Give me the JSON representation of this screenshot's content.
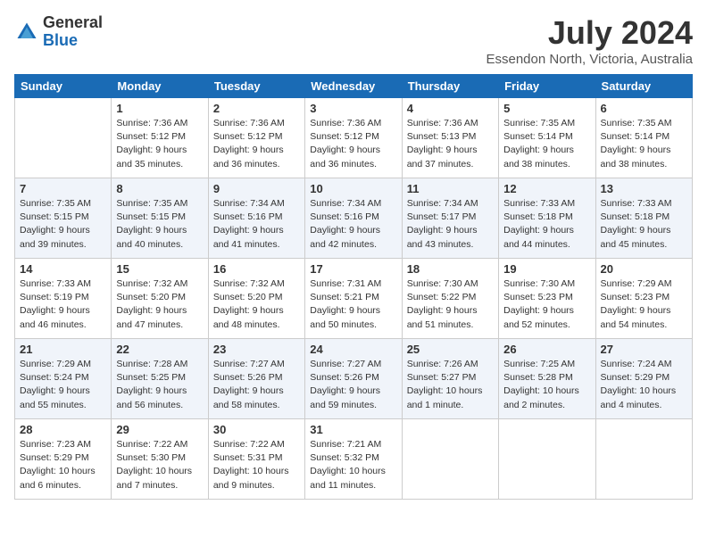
{
  "header": {
    "logo_general": "General",
    "logo_blue": "Blue",
    "month_title": "July 2024",
    "location": "Essendon North, Victoria, Australia"
  },
  "weekdays": [
    "Sunday",
    "Monday",
    "Tuesday",
    "Wednesday",
    "Thursday",
    "Friday",
    "Saturday"
  ],
  "weeks": [
    [
      {
        "day": "",
        "sunrise": "",
        "sunset": "",
        "daylight": ""
      },
      {
        "day": "1",
        "sunrise": "Sunrise: 7:36 AM",
        "sunset": "Sunset: 5:12 PM",
        "daylight": "Daylight: 9 hours and 35 minutes."
      },
      {
        "day": "2",
        "sunrise": "Sunrise: 7:36 AM",
        "sunset": "Sunset: 5:12 PM",
        "daylight": "Daylight: 9 hours and 36 minutes."
      },
      {
        "day": "3",
        "sunrise": "Sunrise: 7:36 AM",
        "sunset": "Sunset: 5:12 PM",
        "daylight": "Daylight: 9 hours and 36 minutes."
      },
      {
        "day": "4",
        "sunrise": "Sunrise: 7:36 AM",
        "sunset": "Sunset: 5:13 PM",
        "daylight": "Daylight: 9 hours and 37 minutes."
      },
      {
        "day": "5",
        "sunrise": "Sunrise: 7:35 AM",
        "sunset": "Sunset: 5:14 PM",
        "daylight": "Daylight: 9 hours and 38 minutes."
      },
      {
        "day": "6",
        "sunrise": "Sunrise: 7:35 AM",
        "sunset": "Sunset: 5:14 PM",
        "daylight": "Daylight: 9 hours and 38 minutes."
      }
    ],
    [
      {
        "day": "7",
        "sunrise": "Sunrise: 7:35 AM",
        "sunset": "Sunset: 5:15 PM",
        "daylight": "Daylight: 9 hours and 39 minutes."
      },
      {
        "day": "8",
        "sunrise": "Sunrise: 7:35 AM",
        "sunset": "Sunset: 5:15 PM",
        "daylight": "Daylight: 9 hours and 40 minutes."
      },
      {
        "day": "9",
        "sunrise": "Sunrise: 7:34 AM",
        "sunset": "Sunset: 5:16 PM",
        "daylight": "Daylight: 9 hours and 41 minutes."
      },
      {
        "day": "10",
        "sunrise": "Sunrise: 7:34 AM",
        "sunset": "Sunset: 5:16 PM",
        "daylight": "Daylight: 9 hours and 42 minutes."
      },
      {
        "day": "11",
        "sunrise": "Sunrise: 7:34 AM",
        "sunset": "Sunset: 5:17 PM",
        "daylight": "Daylight: 9 hours and 43 minutes."
      },
      {
        "day": "12",
        "sunrise": "Sunrise: 7:33 AM",
        "sunset": "Sunset: 5:18 PM",
        "daylight": "Daylight: 9 hours and 44 minutes."
      },
      {
        "day": "13",
        "sunrise": "Sunrise: 7:33 AM",
        "sunset": "Sunset: 5:18 PM",
        "daylight": "Daylight: 9 hours and 45 minutes."
      }
    ],
    [
      {
        "day": "14",
        "sunrise": "Sunrise: 7:33 AM",
        "sunset": "Sunset: 5:19 PM",
        "daylight": "Daylight: 9 hours and 46 minutes."
      },
      {
        "day": "15",
        "sunrise": "Sunrise: 7:32 AM",
        "sunset": "Sunset: 5:20 PM",
        "daylight": "Daylight: 9 hours and 47 minutes."
      },
      {
        "day": "16",
        "sunrise": "Sunrise: 7:32 AM",
        "sunset": "Sunset: 5:20 PM",
        "daylight": "Daylight: 9 hours and 48 minutes."
      },
      {
        "day": "17",
        "sunrise": "Sunrise: 7:31 AM",
        "sunset": "Sunset: 5:21 PM",
        "daylight": "Daylight: 9 hours and 50 minutes."
      },
      {
        "day": "18",
        "sunrise": "Sunrise: 7:30 AM",
        "sunset": "Sunset: 5:22 PM",
        "daylight": "Daylight: 9 hours and 51 minutes."
      },
      {
        "day": "19",
        "sunrise": "Sunrise: 7:30 AM",
        "sunset": "Sunset: 5:23 PM",
        "daylight": "Daylight: 9 hours and 52 minutes."
      },
      {
        "day": "20",
        "sunrise": "Sunrise: 7:29 AM",
        "sunset": "Sunset: 5:23 PM",
        "daylight": "Daylight: 9 hours and 54 minutes."
      }
    ],
    [
      {
        "day": "21",
        "sunrise": "Sunrise: 7:29 AM",
        "sunset": "Sunset: 5:24 PM",
        "daylight": "Daylight: 9 hours and 55 minutes."
      },
      {
        "day": "22",
        "sunrise": "Sunrise: 7:28 AM",
        "sunset": "Sunset: 5:25 PM",
        "daylight": "Daylight: 9 hours and 56 minutes."
      },
      {
        "day": "23",
        "sunrise": "Sunrise: 7:27 AM",
        "sunset": "Sunset: 5:26 PM",
        "daylight": "Daylight: 9 hours and 58 minutes."
      },
      {
        "day": "24",
        "sunrise": "Sunrise: 7:27 AM",
        "sunset": "Sunset: 5:26 PM",
        "daylight": "Daylight: 9 hours and 59 minutes."
      },
      {
        "day": "25",
        "sunrise": "Sunrise: 7:26 AM",
        "sunset": "Sunset: 5:27 PM",
        "daylight": "Daylight: 10 hours and 1 minute."
      },
      {
        "day": "26",
        "sunrise": "Sunrise: 7:25 AM",
        "sunset": "Sunset: 5:28 PM",
        "daylight": "Daylight: 10 hours and 2 minutes."
      },
      {
        "day": "27",
        "sunrise": "Sunrise: 7:24 AM",
        "sunset": "Sunset: 5:29 PM",
        "daylight": "Daylight: 10 hours and 4 minutes."
      }
    ],
    [
      {
        "day": "28",
        "sunrise": "Sunrise: 7:23 AM",
        "sunset": "Sunset: 5:29 PM",
        "daylight": "Daylight: 10 hours and 6 minutes."
      },
      {
        "day": "29",
        "sunrise": "Sunrise: 7:22 AM",
        "sunset": "Sunset: 5:30 PM",
        "daylight": "Daylight: 10 hours and 7 minutes."
      },
      {
        "day": "30",
        "sunrise": "Sunrise: 7:22 AM",
        "sunset": "Sunset: 5:31 PM",
        "daylight": "Daylight: 10 hours and 9 minutes."
      },
      {
        "day": "31",
        "sunrise": "Sunrise: 7:21 AM",
        "sunset": "Sunset: 5:32 PM",
        "daylight": "Daylight: 10 hours and 11 minutes."
      },
      {
        "day": "",
        "sunrise": "",
        "sunset": "",
        "daylight": ""
      },
      {
        "day": "",
        "sunrise": "",
        "sunset": "",
        "daylight": ""
      },
      {
        "day": "",
        "sunrise": "",
        "sunset": "",
        "daylight": ""
      }
    ]
  ]
}
